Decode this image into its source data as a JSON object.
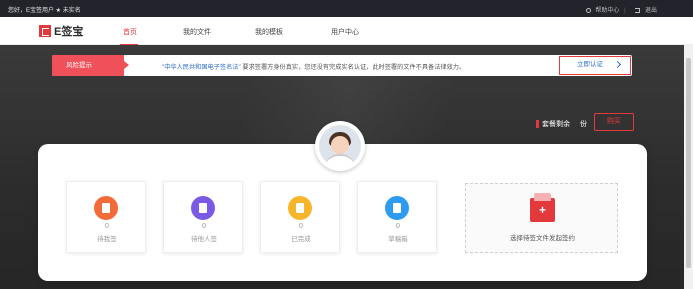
{
  "topbar": {
    "greeting": "您好，E宝签用户 ★ 未实名",
    "help": "帮助中心",
    "logout": "退出"
  },
  "brand": {
    "name": "E签宝",
    "color": "#e4393c"
  },
  "nav": {
    "items": [
      {
        "label": "首页",
        "active": true
      },
      {
        "label": "我的文件",
        "active": false
      },
      {
        "label": "我的模板",
        "active": false
      },
      {
        "label": "用户中心",
        "active": false
      }
    ]
  },
  "risk": {
    "tag": "风险提示",
    "law": "\"中华人民共和国电子签名法\"",
    "message": "要求签署方身份真实，您还没有完成实名认证，此时签署的文件不具备法律效力。",
    "action": "立即认证"
  },
  "package": {
    "label": "套餐剩余",
    "unit": "份",
    "buy": "购买"
  },
  "stats": [
    {
      "label": "待我签",
      "count": "0",
      "color": "#f26b3a",
      "icon": "pen-icon"
    },
    {
      "label": "待他人签",
      "count": "0",
      "color": "#7b5be6",
      "icon": "user-icon"
    },
    {
      "label": "已完成",
      "count": "0",
      "color": "#f7b52c",
      "icon": "check-doc-icon"
    },
    {
      "label": "草稿箱",
      "count": "0",
      "color": "#2d9cf0",
      "icon": "draft-icon"
    }
  ],
  "upload": {
    "label": "选择待签文件发起签约"
  }
}
